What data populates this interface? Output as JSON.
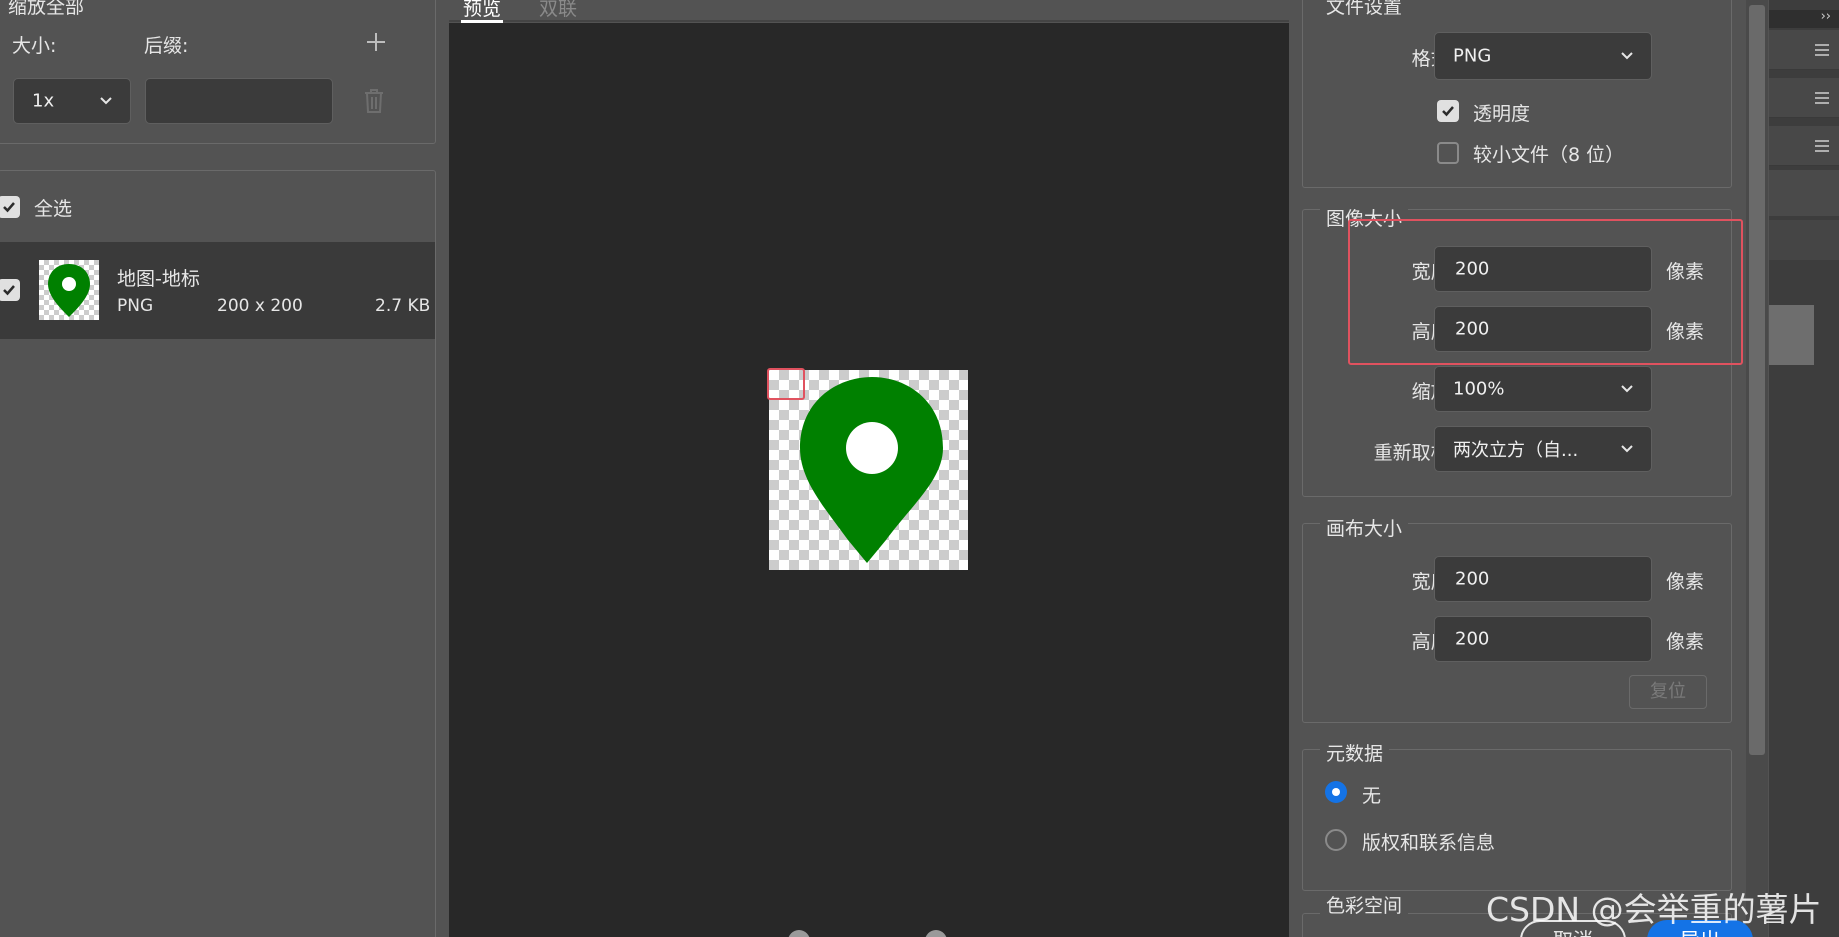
{
  "left": {
    "scale_all": {
      "legend": "缩放全部",
      "size_label": "大小:",
      "suffix_label": "后缀:",
      "size_value": "1x",
      "suffix_value": ""
    },
    "select_all_label": "全选",
    "asset": {
      "name": "地图-地标",
      "format": "PNG",
      "dimensions": "200 x 200",
      "filesize": "2.7 KB"
    }
  },
  "center": {
    "tabs": [
      {
        "label": "预览"
      },
      {
        "label": "双联"
      }
    ]
  },
  "right": {
    "file_settings": {
      "legend": "文件设置",
      "format_label": "格式:",
      "format_value": "PNG",
      "transparency_label": "透明度",
      "smaller_file_label": "较小文件（8 位）"
    },
    "image_size": {
      "legend": "图像大小",
      "width_label": "宽度:",
      "width_value": "200",
      "height_label": "高度:",
      "height_value": "200",
      "unit": "像素",
      "scale_label": "缩放:",
      "scale_value": "100%",
      "resample_label": "重新取样:",
      "resample_value": "两次立方（自..."
    },
    "canvas_size": {
      "legend": "画布大小",
      "width_label": "宽度:",
      "width_value": "200",
      "height_label": "高度:",
      "height_value": "200",
      "unit": "像素",
      "reset_label": "复位"
    },
    "metadata": {
      "legend": "元数据",
      "none_label": "无",
      "copyright_label": "版权和联系信息"
    },
    "color_space": {
      "legend": "色彩空间"
    }
  },
  "footer": {
    "cancel_label": "取消",
    "export_label": "导出"
  },
  "watermark": "CSDN @会举重的薯片",
  "colors": {
    "accent": "#1473e6",
    "highlight": "#e0525f",
    "pin": "#008000"
  }
}
